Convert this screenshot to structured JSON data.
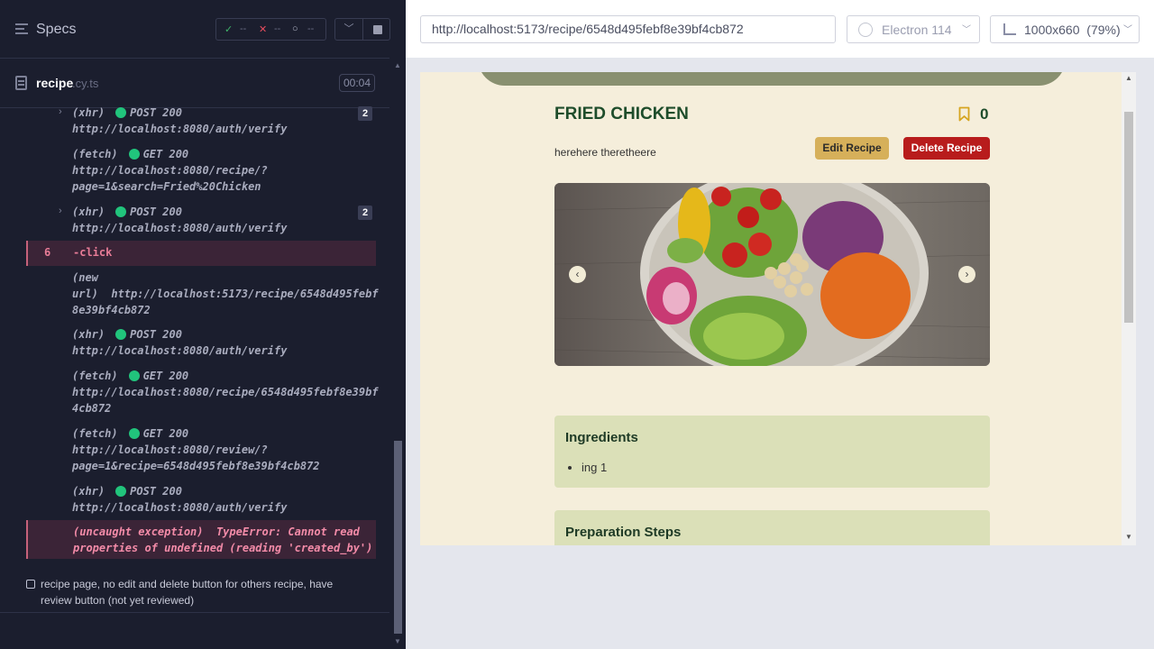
{
  "reporter": {
    "title": "Specs",
    "stats": {
      "passed": "--",
      "failed": "--",
      "pending": "--"
    },
    "spec": {
      "name": "recipe",
      "ext": ".cy.ts",
      "time": "00:04"
    },
    "logs": [
      {
        "type": "(xhr)",
        "method": "POST 200",
        "url": "http://localhost:8080/auth/verify",
        "count": "2"
      },
      {
        "type": "(fetch)",
        "method": "GET 200",
        "url": "http://localhost:8080/recipe/?",
        "url2": "page=1&search=Fried%20Chicken"
      },
      {
        "type": "(xhr)",
        "method": "POST 200",
        "url": "http://localhost:8080/auth/verify",
        "count": "2"
      }
    ],
    "command": {
      "number": "6",
      "name": "-click"
    },
    "logs2": [
      {
        "type": "(new",
        "type2": "url)",
        "url": "http://localhost:5173/recipe/6548d495febf",
        "url2": "8e39bf4cb872"
      },
      {
        "type": "(xhr)",
        "method": "POST 200",
        "url": "http://localhost:8080/auth/verify"
      },
      {
        "type": "(fetch)",
        "method": "GET 200",
        "url": "http://localhost:8080/recipe/6548d495febf8e39bf",
        "url2": "4cb872"
      },
      {
        "type": "(fetch)",
        "method": "GET 200",
        "url": "http://localhost:8080/review/?",
        "url2": "page=1&recipe=6548d495febf8e39bf4cb872"
      },
      {
        "type": "(xhr)",
        "method": "POST 200",
        "url": "http://localhost:8080/auth/verify"
      }
    ],
    "error": {
      "label": "(uncaught exception)",
      "message": "TypeError: Cannot read",
      "message2": "properties of undefined (reading 'created_by')"
    },
    "test": "recipe page, no edit and delete button for others recipe, have review button (not yet reviewed)"
  },
  "aut": {
    "url": "http://localhost:5173/recipe/6548d495febf8e39bf4cb872",
    "browser": "Electron 114",
    "viewport": "1000x660",
    "zoom": "(79%)",
    "page": {
      "title": "FRIED CHICKEN",
      "bookmark_count": "0",
      "description": "herehere theretheere",
      "edit_label": "Edit Recipe",
      "delete_label": "Delete Recipe",
      "ingredients_title": "Ingredients",
      "ingredients": [
        "ing 1"
      ],
      "prep_title": "Preparation Steps"
    },
    "colors": {
      "accent": "#1e4d2b",
      "edit": "#d6b05a",
      "delete": "#b81c1c",
      "card": "#dbe0b8",
      "page_bg": "#f5eedb"
    }
  }
}
